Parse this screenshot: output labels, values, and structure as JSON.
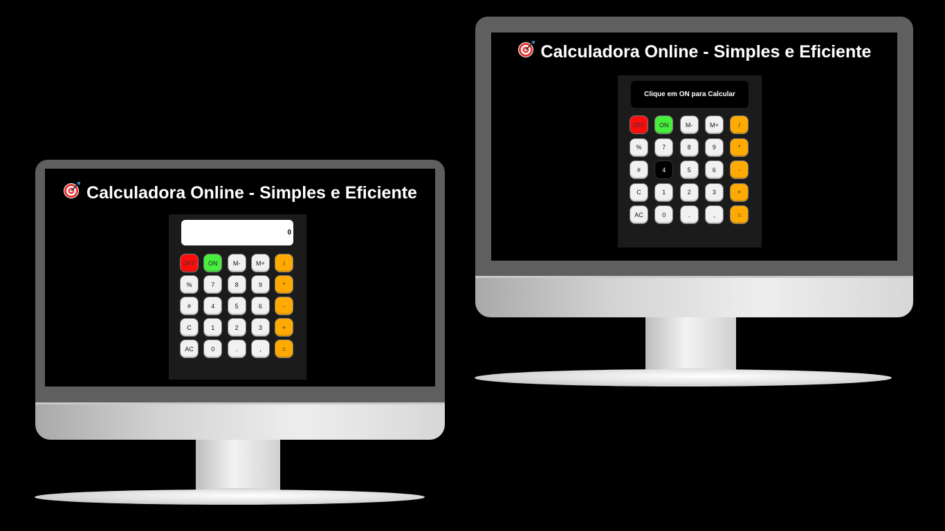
{
  "app": {
    "title": "Calculadora Online - Simples e Eficiente",
    "title_icon": "direct-hit-target-icon"
  },
  "colors": {
    "bezel": "#5f5f5f",
    "calculator_body": "#1b1b1b",
    "off_key": "#ff0d0d",
    "on_key": "#48ee3e",
    "operator_key": "#ffaa00",
    "number_key": "#f1f1f1"
  },
  "monitors": [
    {
      "display_text": "0",
      "pressed_key": null
    },
    {
      "display_text": "Clique em ON para Calcular",
      "pressed_key": "4"
    }
  ],
  "keypad": {
    "rows": [
      [
        {
          "label": "OFF",
          "type": "off"
        },
        {
          "label": "ON",
          "type": "on"
        },
        {
          "label": "M-",
          "type": "num"
        },
        {
          "label": "M+",
          "type": "num"
        },
        {
          "label": "/",
          "type": "op"
        }
      ],
      [
        {
          "label": "%",
          "type": "num"
        },
        {
          "label": "7",
          "type": "num"
        },
        {
          "label": "8",
          "type": "num"
        },
        {
          "label": "9",
          "type": "num"
        },
        {
          "label": "*",
          "type": "op"
        }
      ],
      [
        {
          "label": "#",
          "type": "num"
        },
        {
          "label": "4",
          "type": "num"
        },
        {
          "label": "5",
          "type": "num"
        },
        {
          "label": "6",
          "type": "num"
        },
        {
          "label": "-",
          "type": "op"
        }
      ],
      [
        {
          "label": "C",
          "type": "num"
        },
        {
          "label": "1",
          "type": "num"
        },
        {
          "label": "2",
          "type": "num"
        },
        {
          "label": "3",
          "type": "num"
        },
        {
          "label": "+",
          "type": "op"
        }
      ],
      [
        {
          "label": "AC",
          "type": "num"
        },
        {
          "label": "0",
          "type": "num"
        },
        {
          "label": ".",
          "type": "num"
        },
        {
          "label": ",",
          "type": "num"
        },
        {
          "label": "=",
          "type": "op"
        }
      ]
    ]
  }
}
